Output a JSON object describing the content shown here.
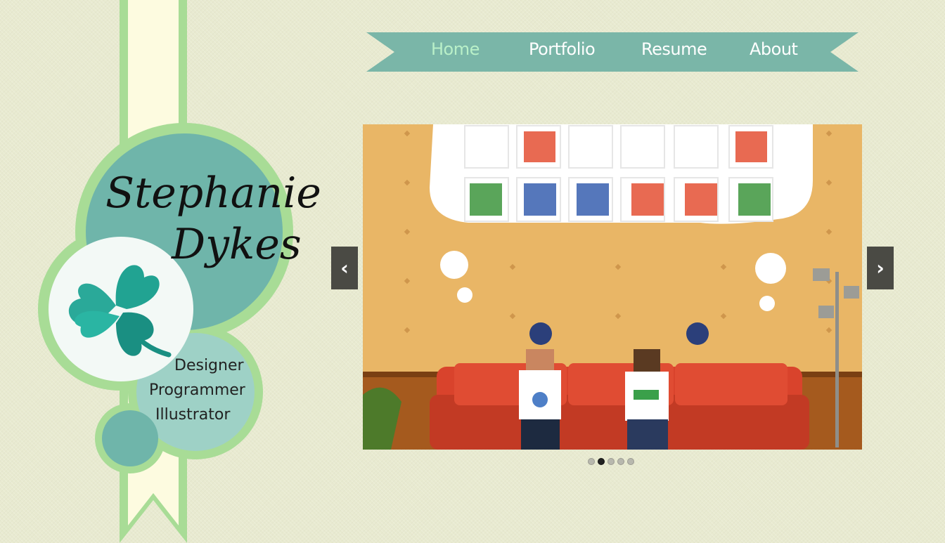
{
  "brand": {
    "first_name": "Stephanie",
    "last_name": "Dykes",
    "roles": [
      "Designer",
      "Programmer",
      "Illustrator"
    ],
    "logo_icon": "four-leaf-clover-icon"
  },
  "nav": {
    "items": [
      {
        "label": "Home",
        "active": true
      },
      {
        "label": "Portfolio",
        "active": false
      },
      {
        "label": "Resume",
        "active": false
      },
      {
        "label": "About",
        "active": false
      }
    ]
  },
  "slider": {
    "prev_icon": "‹",
    "next_icon": "›",
    "slide_count": 5,
    "active_index": 1,
    "slide_description_icon": "pixel-art-game-scene"
  },
  "colors": {
    "background": "#e8ead0",
    "ribbon_fill": "#fdfbe0",
    "ribbon_border": "#a8dc96",
    "teal": "#6fb5aa",
    "light_teal": "#9ed1c6",
    "banner": "#7ab6a8",
    "nav_active": "#b9f0c8"
  }
}
